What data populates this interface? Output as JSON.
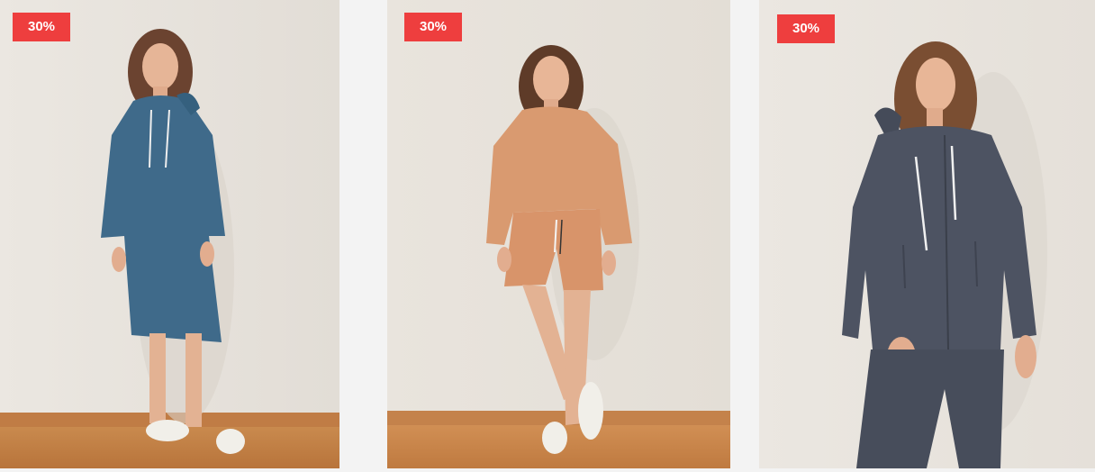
{
  "products": [
    {
      "badge": "30%",
      "image_icon": "model-blue-hoodie-dress",
      "colors": {
        "garment": "#3f6a8a"
      }
    },
    {
      "badge": "30%",
      "image_icon": "model-orange-sweatshirt-shorts",
      "colors": {
        "garment": "#d99a70"
      }
    },
    {
      "badge": "30%",
      "image_icon": "model-charcoal-zip-hoodie-set",
      "colors": {
        "garment": "#4d5362"
      }
    }
  ],
  "colors": {
    "badge": "#ee3e3e",
    "wall": "#e8e3dc",
    "floor": "#c98a4e"
  }
}
